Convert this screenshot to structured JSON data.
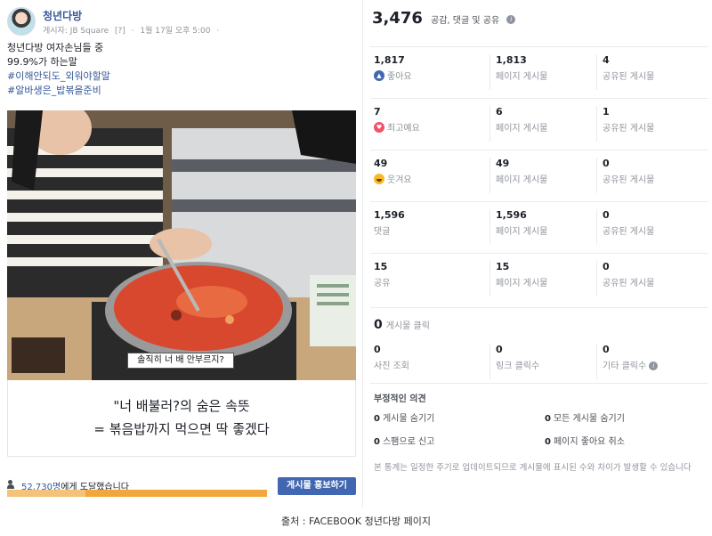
{
  "post": {
    "page_name": "청년다방",
    "meta_poster": "게시자: JB Square",
    "meta_edit": "[?]",
    "meta_sep": "·",
    "meta_time": "1월 17일 오후 5:00",
    "meta_globe": "·",
    "text_line1": "청년다방 여자손님들 중",
    "text_line2": "99.9%가 하는말",
    "hashtag1": "#이해안되도_외워야할말",
    "hashtag2": "#알바생은_밥볶을준비",
    "photo_subtitle": "솔직히 너 배 안부르지?",
    "caption_line1": "\"너 배불러?의 숨은 속뜻",
    "caption_line2": "= 볶음밥까지 먹으면 딱 좋겠다",
    "reach_number": "52,730명",
    "reach_suffix": "에게 도달했습니다",
    "reach_progress": 0.3,
    "boost_label": "게시물 홍보하기"
  },
  "stats": {
    "total": "3,476",
    "total_label": "공감, 댓글 및 공유",
    "info_glyph": "i",
    "rows": [
      {
        "icon": "like-icon",
        "value": "1,817",
        "label": "좋아요",
        "page_value": "1,813",
        "page_label": "페이지 게시물",
        "shared_value": "4",
        "shared_label": "공유된 게시물"
      },
      {
        "icon": "love-icon",
        "value": "7",
        "label": "최고예요",
        "page_value": "6",
        "page_label": "페이지 게시물",
        "shared_value": "1",
        "shared_label": "공유된 게시물"
      },
      {
        "icon": "haha-icon",
        "value": "49",
        "label": "웃겨요",
        "page_value": "49",
        "page_label": "페이지 게시물",
        "shared_value": "0",
        "shared_label": "공유된 게시물"
      },
      {
        "icon": "",
        "value": "1,596",
        "label": "댓글",
        "page_value": "1,596",
        "page_label": "페이지 게시물",
        "shared_value": "0",
        "shared_label": "공유된 게시물"
      },
      {
        "icon": "",
        "value": "15",
        "label": "공유",
        "page_value": "15",
        "page_label": "페이지 게시물",
        "shared_value": "0",
        "shared_label": "공유된 게시물"
      }
    ],
    "clicks": {
      "total": "0",
      "total_label": "게시물 클릭",
      "photo_value": "0",
      "photo_label": "사진 조회",
      "link_value": "0",
      "link_label": "링크 클릭수",
      "other_value": "0",
      "other_label": "기타 클릭수"
    },
    "negative": {
      "title": "부정적인 의견",
      "hide_post_value": "0",
      "hide_post_label": "게시물 숨기기",
      "hide_all_value": "0",
      "hide_all_label": "모든 게시물 숨기기",
      "spam_value": "0",
      "spam_label": "스팸으로 신고",
      "unlike_value": "0",
      "unlike_label": "페이지 좋아요 취소"
    },
    "note": "본 통계는 일정한 주기로 업데이트되므로 게시물에 표시된 수와 차이가 발생할 수 있습니다"
  },
  "source": "출처 : FACEBOOK 청년다방 페이지",
  "colors": {
    "link": "#365899",
    "button": "#4267b2",
    "bar": "#f2a73c"
  }
}
